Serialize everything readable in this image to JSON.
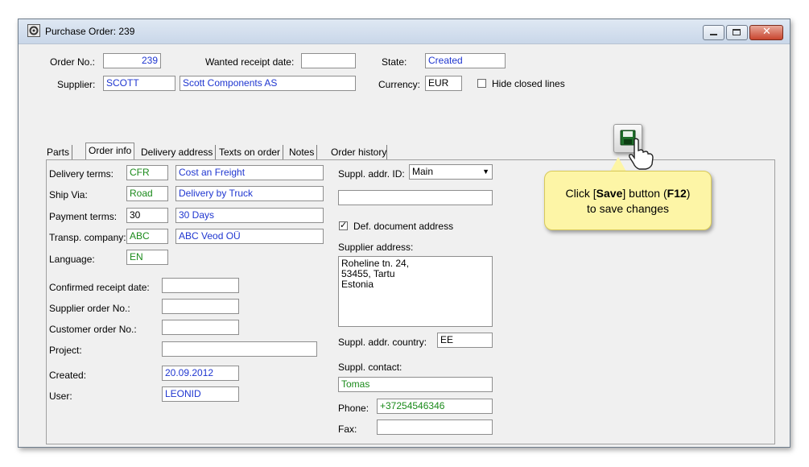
{
  "window": {
    "title": "Purchase Order: 239"
  },
  "header": {
    "order_no_label": "Order No.:",
    "order_no": "239",
    "wanted_date_label": "Wanted receipt date:",
    "wanted_date": "",
    "state_label": "State:",
    "state": "Created",
    "supplier_label": "Supplier:",
    "supplier_code": "SCOTT",
    "supplier_name": "Scott Components AS",
    "currency_label": "Currency:",
    "currency": "EUR",
    "hide_closed_label": "Hide closed lines"
  },
  "tabs": [
    "Parts",
    "Order info",
    "Delivery address",
    "Texts on order",
    "Notes",
    "Order history"
  ],
  "left": {
    "delivery_terms_label": "Delivery terms:",
    "delivery_terms_code": "CFR",
    "delivery_terms": "Cost an Freight",
    "ship_via_label": "Ship Via:",
    "ship_via_code": "Road",
    "ship_via": "Delivery by Truck",
    "payment_terms_label": "Payment terms:",
    "payment_terms_code": "30",
    "payment_terms": "30 Days",
    "transp_label": "Transp. company:",
    "transp_code": "ABC",
    "transp": "ABC Veod OÜ",
    "language_label": "Language:",
    "language": "EN",
    "confirmed_label": "Confirmed receipt date:",
    "confirmed": "",
    "supplier_order_label": "Supplier order No.:",
    "supplier_order": "",
    "customer_order_label": "Customer order No.:",
    "customer_order": "",
    "project_label": "Project:",
    "project": "",
    "created_label": "Created:",
    "created": "20.09.2012",
    "user_label": "User:",
    "user": "LEONID"
  },
  "right": {
    "suppl_addr_id_label": "Suppl. addr. ID:",
    "suppl_addr_id": "Main",
    "suppl_addr_extra": "",
    "def_doc_label": "Def. document address",
    "supplier_address_label": "Supplier address:",
    "address_lines": [
      "Roheline tn. 24,",
      "53455, Tartu",
      "Estonia"
    ],
    "country_label": "Suppl. addr. country:",
    "country": "EE",
    "contact_label": "Suppl. contact:",
    "contact": "Tomas",
    "phone_label": "Phone:",
    "phone": "+37254546346",
    "fax_label": "Fax:",
    "fax": ""
  },
  "tooltip": {
    "pre": "Click [",
    "bold1": "Save",
    "mid": "] button (",
    "bold2": "F12",
    "post": ")",
    "line2": "to save changes"
  },
  "icons": {
    "save": "floppy-disk-icon",
    "cursor": "hand-pointer-icon"
  }
}
